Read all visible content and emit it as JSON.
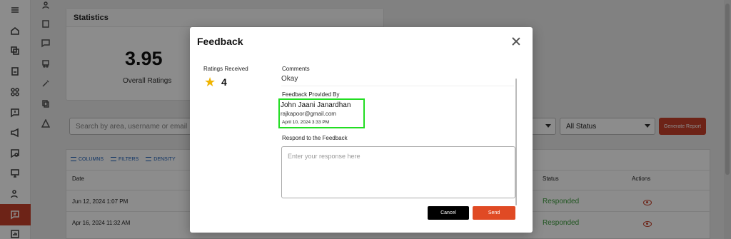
{
  "background": {
    "statistics": {
      "title": "Statistics",
      "overall_rating_value": "3.95",
      "overall_rating_label": "Overall Ratings"
    },
    "search_placeholder": "Search by area, username or email",
    "status_filter_value": "All Status",
    "generate_report_label": "Generate Report",
    "toolbar": {
      "columns_label": "COLUMNS",
      "filters_label": "FILTERS",
      "density_label": "DENSITY"
    },
    "table": {
      "headers": {
        "date": "Date",
        "status": "Status",
        "actions": "Actions"
      },
      "rows": [
        {
          "date": "Jun 12, 2024 1:07 PM",
          "status": "Responded"
        },
        {
          "date": "Apr 16, 2024 11:32 AM",
          "status": "Responded"
        }
      ]
    }
  },
  "modal": {
    "title": "Feedback",
    "ratings_received_label": "Ratings Received",
    "rating_value": "4",
    "comments_label": "Comments",
    "comments_value": "Okay",
    "feedback_provided_by_label": "Feedback Provided By",
    "provider_name": "John Jaani Janardhan",
    "provider_email": "rajkapoor@gmail.com",
    "provided_date": "April 10, 2024 3:33 PM",
    "respond_label": "Respond to the Feedback",
    "response_placeholder": "Enter your response here",
    "cancel_label": "Cancel",
    "send_label": "Send"
  },
  "colors": {
    "accent": "#c7402a",
    "send_button": "#e04a24",
    "highlight_box": "#22dd22",
    "status_green": "#3a9b3a",
    "star": "#f0b400"
  },
  "icons": {
    "rail": [
      "menu-icon",
      "home-icon",
      "copy-icon",
      "document-icon",
      "network-icon",
      "message-icon",
      "megaphone-icon",
      "chat-settings-icon",
      "monitor-icon",
      "users-icon",
      "feedback-icon",
      "chart-icon"
    ]
  }
}
